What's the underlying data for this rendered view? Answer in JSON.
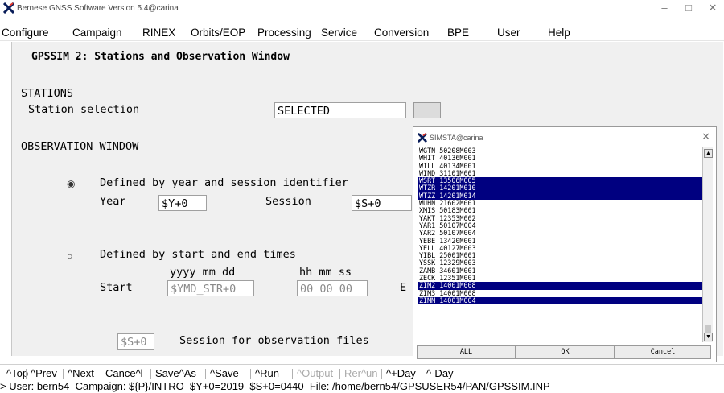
{
  "window": {
    "title": "Bernese GNSS Software Version 5.4@carina",
    "controls": [
      "–",
      "□",
      "✕"
    ]
  },
  "menubar": [
    "Configure",
    "Campaign",
    "RINEX",
    "Orbits/EOP",
    "Processing",
    "Service",
    "Conversion",
    "BPE",
    "User",
    "Help"
  ],
  "panel": {
    "heading": "GPSSIM 2: Stations and Observation Window",
    "stations_label": "STATIONS",
    "station_selection_label": "Station selection",
    "station_selection_value": "SELECTED",
    "observation_window_label": "OBSERVATION WINDOW",
    "option1_label": "Defined by year and session identifier",
    "year_label": "Year",
    "year_value": "$Y+0",
    "session_label": "Session",
    "session_value": "$S+0",
    "option2_label": "Defined by start and end times",
    "date_header": "yyyy mm dd",
    "time_header": "hh mm ss",
    "start_label": "Start",
    "start_date_value": "$YMD_STR+0",
    "start_time_value": "00 00 00",
    "end_partial": "E",
    "obsfile_session_value": "$S+0",
    "obsfile_session_label": "Session for observation files"
  },
  "popup": {
    "title": "SIMSTA@carina",
    "close": "✕",
    "items": [
      {
        "text": "WGTN 50208M003",
        "selected": false
      },
      {
        "text": "WHIT 40136M001",
        "selected": false
      },
      {
        "text": "WILL 40134M001",
        "selected": false
      },
      {
        "text": "WIND 31101M001",
        "selected": false
      },
      {
        "text": "WSRT 13506M005",
        "selected": true
      },
      {
        "text": "WTZR 14201M010",
        "selected": true
      },
      {
        "text": "WTZZ 14201M014",
        "selected": true
      },
      {
        "text": "WUHN 21602M001",
        "selected": false
      },
      {
        "text": "XMIS 50183M001",
        "selected": false
      },
      {
        "text": "YAKT 12353M002",
        "selected": false
      },
      {
        "text": "YAR1 50107M004",
        "selected": false
      },
      {
        "text": "YAR2 50107M004",
        "selected": false
      },
      {
        "text": "YEBE 13420M001",
        "selected": false
      },
      {
        "text": "YELL 40127M003",
        "selected": false
      },
      {
        "text": "YIBL 25001M001",
        "selected": false
      },
      {
        "text": "YSSK 12329M003",
        "selected": false
      },
      {
        "text": "ZAMB 34601M001",
        "selected": false
      },
      {
        "text": "ZECK 12351M001",
        "selected": false
      },
      {
        "text": "ZIM2 14001M008",
        "selected": true
      },
      {
        "text": "ZIM3 14001M008",
        "selected": false
      },
      {
        "text": "ZIMM 14001M004",
        "selected": true
      }
    ],
    "buttons": [
      "ALL",
      "OK",
      "Cancel"
    ]
  },
  "toolbar": [
    {
      "label": "^Top",
      "enabled": true
    },
    {
      "label": "^Prev",
      "enabled": true
    },
    {
      "label": "^Next",
      "enabled": true
    },
    {
      "label": "Cance^l",
      "enabled": true
    },
    {
      "label": "Save^As",
      "enabled": true
    },
    {
      "label": "^Save",
      "enabled": true
    },
    {
      "label": "^Run",
      "enabled": true
    },
    {
      "label": "^Output",
      "enabled": false
    },
    {
      "label": "Rer^un",
      "enabled": false
    },
    {
      "label": "^+Day",
      "enabled": true
    },
    {
      "label": "^-Day",
      "enabled": true
    }
  ],
  "status": "> User: bern54  Campaign: ${P}/INTRO  $Y+0=2019  $S+0=0440  File: /home/bern54/GPSUSER54/PAN/GPSSIM.INP",
  "colors": {
    "selection": "#000080",
    "panel_bg": "#f0f0f0",
    "disabled_text": "#aaaaaa"
  }
}
